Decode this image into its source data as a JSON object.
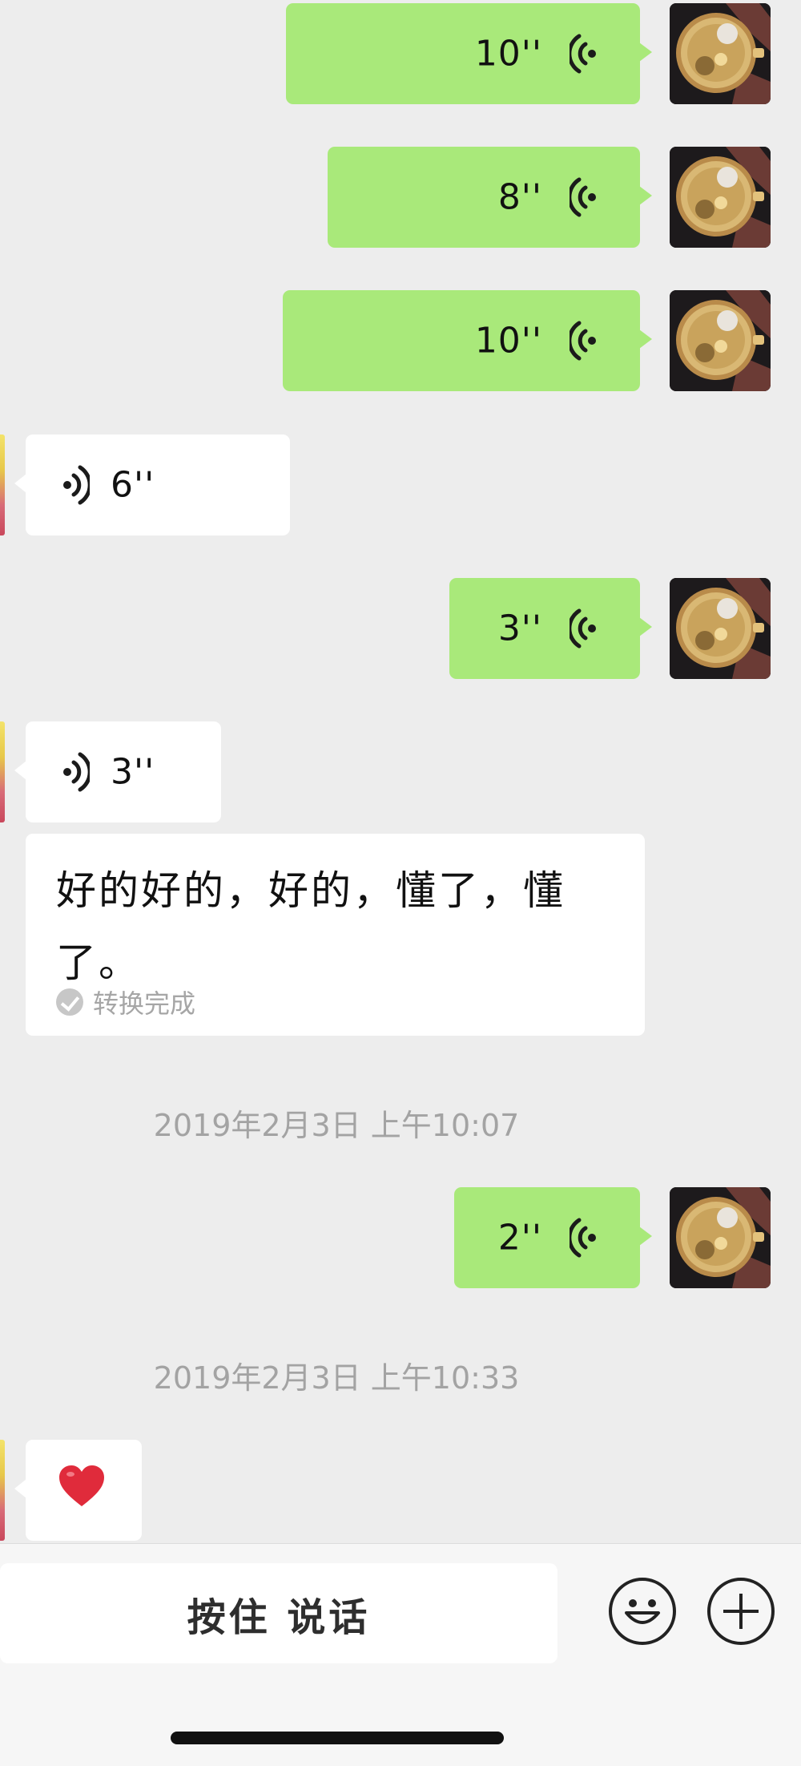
{
  "messages": [
    {
      "direction": "sent",
      "duration": "10''"
    },
    {
      "direction": "sent",
      "duration": "8''"
    },
    {
      "direction": "sent",
      "duration": "10''"
    },
    {
      "direction": "received",
      "duration": "6''"
    },
    {
      "direction": "sent",
      "duration": "3''"
    },
    {
      "direction": "received",
      "duration": "3''"
    },
    {
      "direction": "sent",
      "duration": "2''"
    }
  ],
  "transcription": {
    "text": "好的好的，好的，懂了，懂了。",
    "status": "转换完成"
  },
  "timestamps": [
    "2019年2月3日 上午10:07",
    "2019年2月3日 上午10:33"
  ],
  "last_message": {
    "emoji": "heart"
  },
  "input_bar": {
    "hold_to_talk": "按住 说话",
    "icons": [
      "emoji-icon",
      "plus-icon"
    ]
  },
  "colors": {
    "sent_bubble": "#a9e97a",
    "received_bubble": "#ffffff",
    "background": "#ededed",
    "heart": "#e02b3b"
  }
}
